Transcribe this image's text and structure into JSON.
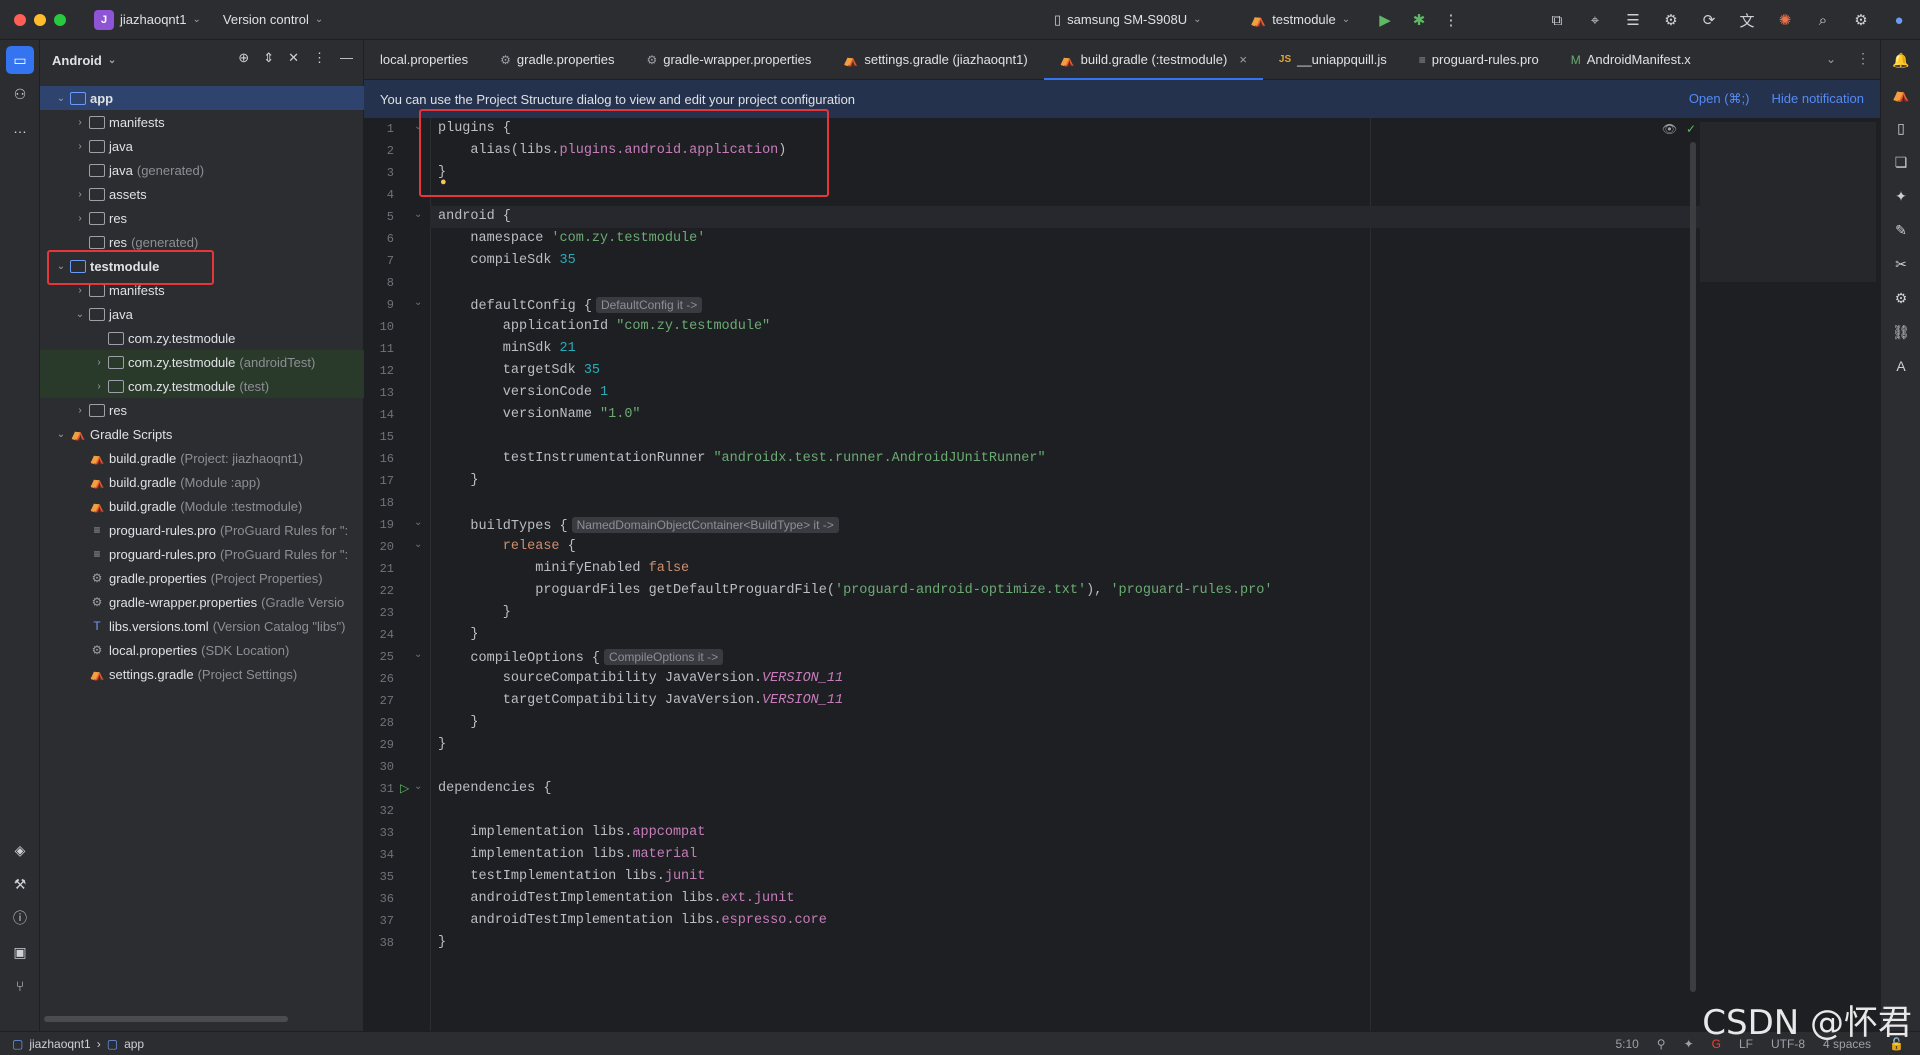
{
  "titlebar": {
    "project_initial": "J",
    "project_name": "jiazhaoqnt1",
    "vcs": "Version control",
    "device": "samsung SM-S908U",
    "run_config": "testmodule"
  },
  "project_panel": {
    "title": "Android",
    "tree": [
      {
        "label": "app",
        "hint": "",
        "depth": 0,
        "arrow": "v",
        "icon": "module",
        "selected": true
      },
      {
        "label": "manifests",
        "hint": "",
        "depth": 1,
        "arrow": ">",
        "icon": "folder"
      },
      {
        "label": "java",
        "hint": "",
        "depth": 1,
        "arrow": ">",
        "icon": "folder"
      },
      {
        "label": "java",
        "hint": "(generated)",
        "depth": 1,
        "arrow": "",
        "icon": "folder"
      },
      {
        "label": "assets",
        "hint": "",
        "depth": 1,
        "arrow": ">",
        "icon": "folder"
      },
      {
        "label": "res",
        "hint": "",
        "depth": 1,
        "arrow": ">",
        "icon": "folder"
      },
      {
        "label": "res",
        "hint": "(generated)",
        "depth": 1,
        "arrow": "",
        "icon": "folder"
      },
      {
        "label": "testmodule",
        "hint": "",
        "depth": 0,
        "arrow": "v",
        "icon": "module",
        "bold": true
      },
      {
        "label": "manifests",
        "hint": "",
        "depth": 1,
        "arrow": ">",
        "icon": "folder"
      },
      {
        "label": "java",
        "hint": "",
        "depth": 1,
        "arrow": "v",
        "icon": "folder"
      },
      {
        "label": "com.zy.testmodule",
        "hint": "",
        "depth": 2,
        "arrow": "",
        "icon": "folder"
      },
      {
        "label": "com.zy.testmodule",
        "hint": "(androidTest)",
        "depth": 2,
        "arrow": ">",
        "icon": "folder",
        "green": true
      },
      {
        "label": "com.zy.testmodule",
        "hint": "(test)",
        "depth": 2,
        "arrow": ">",
        "icon": "folder",
        "green": true
      },
      {
        "label": "res",
        "hint": "",
        "depth": 1,
        "arrow": ">",
        "icon": "folder"
      },
      {
        "label": "Gradle Scripts",
        "hint": "",
        "depth": 0,
        "arrow": "v",
        "icon": "gradle"
      },
      {
        "label": "build.gradle",
        "hint": "(Project: jiazhaoqnt1)",
        "depth": 1,
        "arrow": "",
        "icon": "gradle"
      },
      {
        "label": "build.gradle",
        "hint": "(Module :app)",
        "depth": 1,
        "arrow": "",
        "icon": "gradle"
      },
      {
        "label": "build.gradle",
        "hint": "(Module :testmodule)",
        "depth": 1,
        "arrow": "",
        "icon": "gradle"
      },
      {
        "label": "proguard-rules.pro",
        "hint": "(ProGuard Rules for \":",
        "depth": 1,
        "arrow": "",
        "icon": "text"
      },
      {
        "label": "proguard-rules.pro",
        "hint": "(ProGuard Rules for \":",
        "depth": 1,
        "arrow": "",
        "icon": "text"
      },
      {
        "label": "gradle.properties",
        "hint": "(Project Properties)",
        "depth": 1,
        "arrow": "",
        "icon": "gear"
      },
      {
        "label": "gradle-wrapper.properties",
        "hint": "(Gradle Versio",
        "depth": 1,
        "arrow": "",
        "icon": "gear"
      },
      {
        "label": "libs.versions.toml",
        "hint": "(Version Catalog \"libs\")",
        "depth": 1,
        "arrow": "",
        "icon": "toml"
      },
      {
        "label": "local.properties",
        "hint": "(SDK Location)",
        "depth": 1,
        "arrow": "",
        "icon": "gear"
      },
      {
        "label": "settings.gradle",
        "hint": "(Project Settings)",
        "depth": 1,
        "arrow": "",
        "icon": "gradle"
      }
    ]
  },
  "tabs": [
    {
      "label": "local.properties",
      "icon": "",
      "active": false
    },
    {
      "label": "gradle.properties",
      "icon": "⚙",
      "active": false
    },
    {
      "label": "gradle-wrapper.properties",
      "icon": "⚙",
      "active": false
    },
    {
      "label": "settings.gradle (jiazhaoqnt1)",
      "icon": "⛺",
      "active": false
    },
    {
      "label": "build.gradle (:testmodule)",
      "icon": "⛺",
      "active": true,
      "closable": "×"
    },
    {
      "label": "__uniappquill.js",
      "icon": "JS",
      "active": false
    },
    {
      "label": "proguard-rules.pro",
      "icon": "≡",
      "active": false
    },
    {
      "label": "AndroidManifest.x",
      "icon": "M",
      "active": false
    }
  ],
  "notification": {
    "text": "You can use the Project Structure dialog to view and edit your project configuration",
    "open_link": "Open (⌘;)",
    "hide_link": "Hide notification"
  },
  "code_lines": [
    [
      [
        "k-fn",
        "plugins {"
      ]
    ],
    [
      [
        "k-fn",
        "    alias(libs."
      ],
      [
        "k-prop",
        "plugins.android.application"
      ],
      [
        "k-fn",
        ")"
      ]
    ],
    [
      [
        "k-fn",
        "}"
      ]
    ],
    [
      [
        "k-fn",
        ""
      ]
    ],
    [
      [
        "k-fn",
        "android {"
      ]
    ],
    [
      [
        "k-fn",
        "    namespace "
      ],
      [
        "k-str",
        "'com.zy.testmodule'"
      ]
    ],
    [
      [
        "k-fn",
        "    compileSdk "
      ],
      [
        "k-num",
        "35"
      ]
    ],
    [
      [
        "k-fn",
        ""
      ]
    ],
    [
      [
        "k-fn",
        "    defaultConfig {"
      ],
      [
        "inlay",
        "DefaultConfig it ->"
      ]
    ],
    [
      [
        "k-fn",
        "        applicationId "
      ],
      [
        "k-str",
        "\"com.zy.testmodule\""
      ]
    ],
    [
      [
        "k-fn",
        "        minSdk "
      ],
      [
        "k-num",
        "21"
      ]
    ],
    [
      [
        "k-fn",
        "        targetSdk "
      ],
      [
        "k-num",
        "35"
      ]
    ],
    [
      [
        "k-fn",
        "        versionCode "
      ],
      [
        "k-num",
        "1"
      ]
    ],
    [
      [
        "k-fn",
        "        versionName "
      ],
      [
        "k-str",
        "\"1.0\""
      ]
    ],
    [
      [
        "k-fn",
        ""
      ]
    ],
    [
      [
        "k-fn",
        "        testInstrumentationRunner "
      ],
      [
        "k-str",
        "\"androidx.test.runner.AndroidJUnitRunner\""
      ]
    ],
    [
      [
        "k-fn",
        "    }"
      ]
    ],
    [
      [
        "k-fn",
        ""
      ]
    ],
    [
      [
        "k-fn",
        "    buildTypes {"
      ],
      [
        "inlay",
        "NamedDomainObjectContainer<BuildType> it ->"
      ]
    ],
    [
      [
        "k-kw",
        "        release"
      ],
      [
        "k-fn",
        " {"
      ]
    ],
    [
      [
        "k-fn",
        "            minifyEnabled "
      ],
      [
        "k-kw",
        "false"
      ]
    ],
    [
      [
        "k-fn",
        "            proguardFiles getDefaultProguardFile("
      ],
      [
        "k-str",
        "'proguard-android-optimize.txt'"
      ],
      [
        "k-fn",
        "), "
      ],
      [
        "k-str",
        "'proguard-rules.pro'"
      ]
    ],
    [
      [
        "k-fn",
        "        }"
      ]
    ],
    [
      [
        "k-fn",
        "    }"
      ]
    ],
    [
      [
        "k-fn",
        "    compileOptions {"
      ],
      [
        "inlay",
        "CompileOptions it ->"
      ]
    ],
    [
      [
        "k-fn",
        "        sourceCompatibility JavaVersion."
      ],
      [
        "k-italic",
        "VERSION_11"
      ]
    ],
    [
      [
        "k-fn",
        "        targetCompatibility JavaVersion."
      ],
      [
        "k-italic",
        "VERSION_11"
      ]
    ],
    [
      [
        "k-fn",
        "    }"
      ]
    ],
    [
      [
        "k-fn",
        "}"
      ]
    ],
    [
      [
        "k-fn",
        ""
      ]
    ],
    [
      [
        "k-fn",
        "dependencies {"
      ]
    ],
    [
      [
        "k-fn",
        ""
      ]
    ],
    [
      [
        "k-fn",
        "    implementation libs."
      ],
      [
        "k-prop",
        "appcompat"
      ]
    ],
    [
      [
        "k-fn",
        "    implementation libs."
      ],
      [
        "k-prop",
        "material"
      ]
    ],
    [
      [
        "k-fn",
        "    testImplementation libs."
      ],
      [
        "k-prop",
        "junit"
      ]
    ],
    [
      [
        "k-fn",
        "    androidTestImplementation libs."
      ],
      [
        "k-prop",
        "ext.junit"
      ]
    ],
    [
      [
        "k-fn",
        "    androidTestImplementation libs."
      ],
      [
        "k-prop",
        "espresso.core"
      ]
    ],
    [
      [
        "k-fn",
        "}"
      ]
    ]
  ],
  "statusbar": {
    "breadcrumb_project": "jiazhaoqnt1",
    "breadcrumb_module": "app",
    "caret": "5:10",
    "line_sep": "LF",
    "encoding": "UTF-8",
    "indent": "4 spaces"
  },
  "watermark": "CSDN @怀君",
  "colors": {
    "accent": "#3574f0",
    "highlight_box": "#e5373a"
  }
}
